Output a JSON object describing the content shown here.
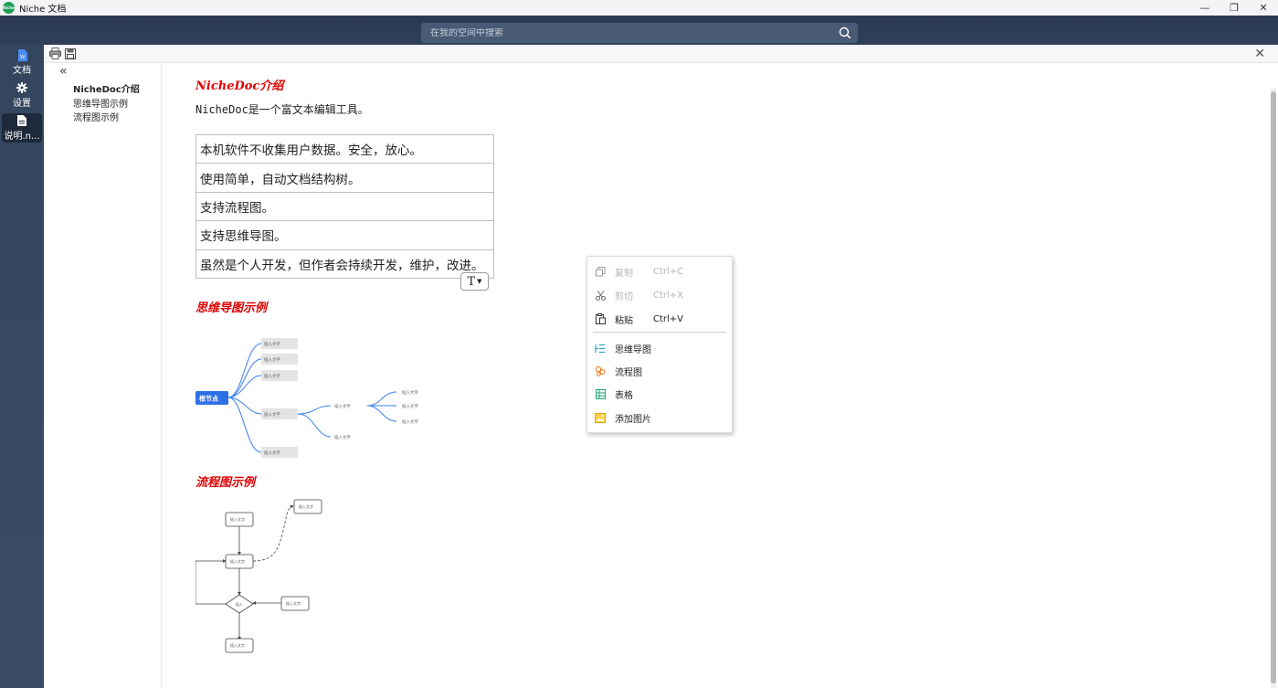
{
  "window": {
    "title": "Niche 文档",
    "logo_text": "Niche",
    "controls": [
      "—",
      "❐",
      "✕"
    ]
  },
  "search": {
    "placeholder": "在我的空间中搜索"
  },
  "nav": {
    "items": [
      {
        "label": "文档",
        "icon": "word-doc-icon"
      },
      {
        "label": "设置",
        "icon": "gear-icon"
      },
      {
        "label": "说明.n...",
        "icon": "file-icon",
        "active": true
      }
    ]
  },
  "toolbar": {
    "close": "✕"
  },
  "toc": {
    "collapse": "«",
    "items": [
      "NicheDoc介绍",
      "思维导图示例",
      "流程图示例"
    ]
  },
  "doc": {
    "h1": "NicheDoc介绍",
    "intro": "NicheDoc是一个富文本编辑工具。",
    "table_rows": [
      "本机软件不收集用户数据。安全，放心。",
      "使用简单，自动文档结构树。",
      "支持流程图。",
      "支持思维导图。",
      "虽然是个人开发，但作者会持续开发，维护，改进。"
    ],
    "format_btn": "T",
    "h2": "思维导图示例",
    "h3": "流程图示例"
  },
  "mindmap": {
    "root": "根节点",
    "node_text": "插入文字"
  },
  "flowchart": {
    "node_text": "插入文字",
    "decision_text": "插入"
  },
  "context_menu": {
    "items": [
      {
        "label": "复制",
        "shortcut": "Ctrl+C",
        "icon": "copy-icon",
        "disabled": true
      },
      {
        "label": "剪切",
        "shortcut": "Ctrl+X",
        "icon": "scissors-icon",
        "disabled": true
      },
      {
        "label": "粘贴",
        "shortcut": "Ctrl+V",
        "icon": "paste-icon",
        "disabled": false
      },
      {
        "label": "思维导图",
        "shortcut": "",
        "icon": "mindmap-icon",
        "disabled": false
      },
      {
        "label": "流程图",
        "shortcut": "",
        "icon": "flowchart-icon",
        "disabled": false
      },
      {
        "label": "表格",
        "shortcut": "",
        "icon": "table-icon",
        "disabled": false
      },
      {
        "label": "添加图片",
        "shortcut": "",
        "icon": "image-icon",
        "disabled": false
      }
    ]
  },
  "colors": {
    "heading": "#e00000",
    "mindmap_line": "#3b7ff0",
    "root_node": "#2f6fe4",
    "nav_bg": "#34455e"
  }
}
